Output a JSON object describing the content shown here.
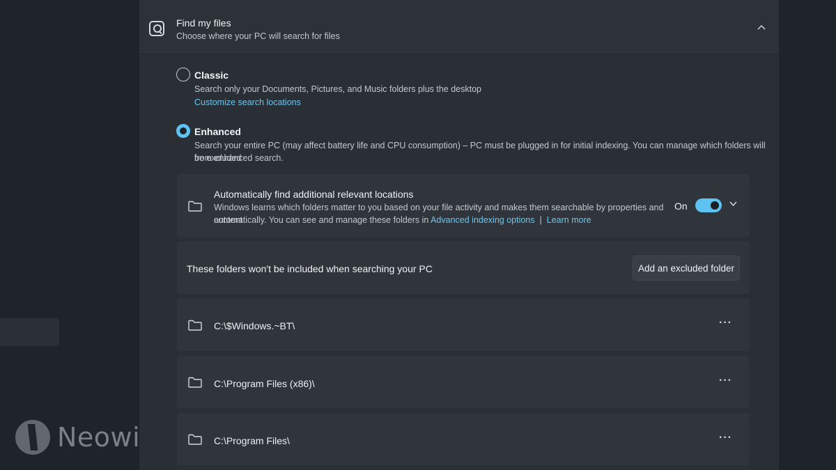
{
  "header": {
    "title": "Find my files",
    "subtitle": "Choose where your PC will search for files",
    "icon": "search-folder-icon"
  },
  "classic": {
    "label": "Classic",
    "description": "Search only your Documents, Pictures, and Music folders plus the desktop",
    "link": "Customize search locations",
    "selected": false
  },
  "enhanced": {
    "label": "Enhanced",
    "description_line1": "Search your entire PC (may affect battery life and CPU consumption) – PC must be plugged in for initial indexing. You can manage which folders will be excluded",
    "description_line2": "from enhanced search.",
    "selected": true
  },
  "auto_locations": {
    "title": "Automatically find additional relevant locations",
    "description_line1": "Windows learns which folders matter to you based on your file activity and makes them searchable by properties and content",
    "description_line2_prefix": "automatically. You can see and manage these folders in ",
    "link_advanced": "Advanced indexing options",
    "separator": "|",
    "link_learn": "Learn more",
    "toggle_label": "On",
    "toggle_on": true
  },
  "excluded": {
    "description": "These folders won't be included when searching your PC",
    "add_button": "Add an excluded folder",
    "folders": [
      {
        "path": "C:\\$Windows.~BT\\"
      },
      {
        "path": "C:\\Program Files (x86)\\"
      },
      {
        "path": "C:\\Program Files\\"
      }
    ],
    "more_label": "···"
  },
  "watermark": {
    "text": "Neowin"
  },
  "colors": {
    "accent": "#5ec3f2",
    "link": "#6cc6ef",
    "background": "#1f242b",
    "panel": "#2a2f36",
    "card": "#30353c"
  }
}
